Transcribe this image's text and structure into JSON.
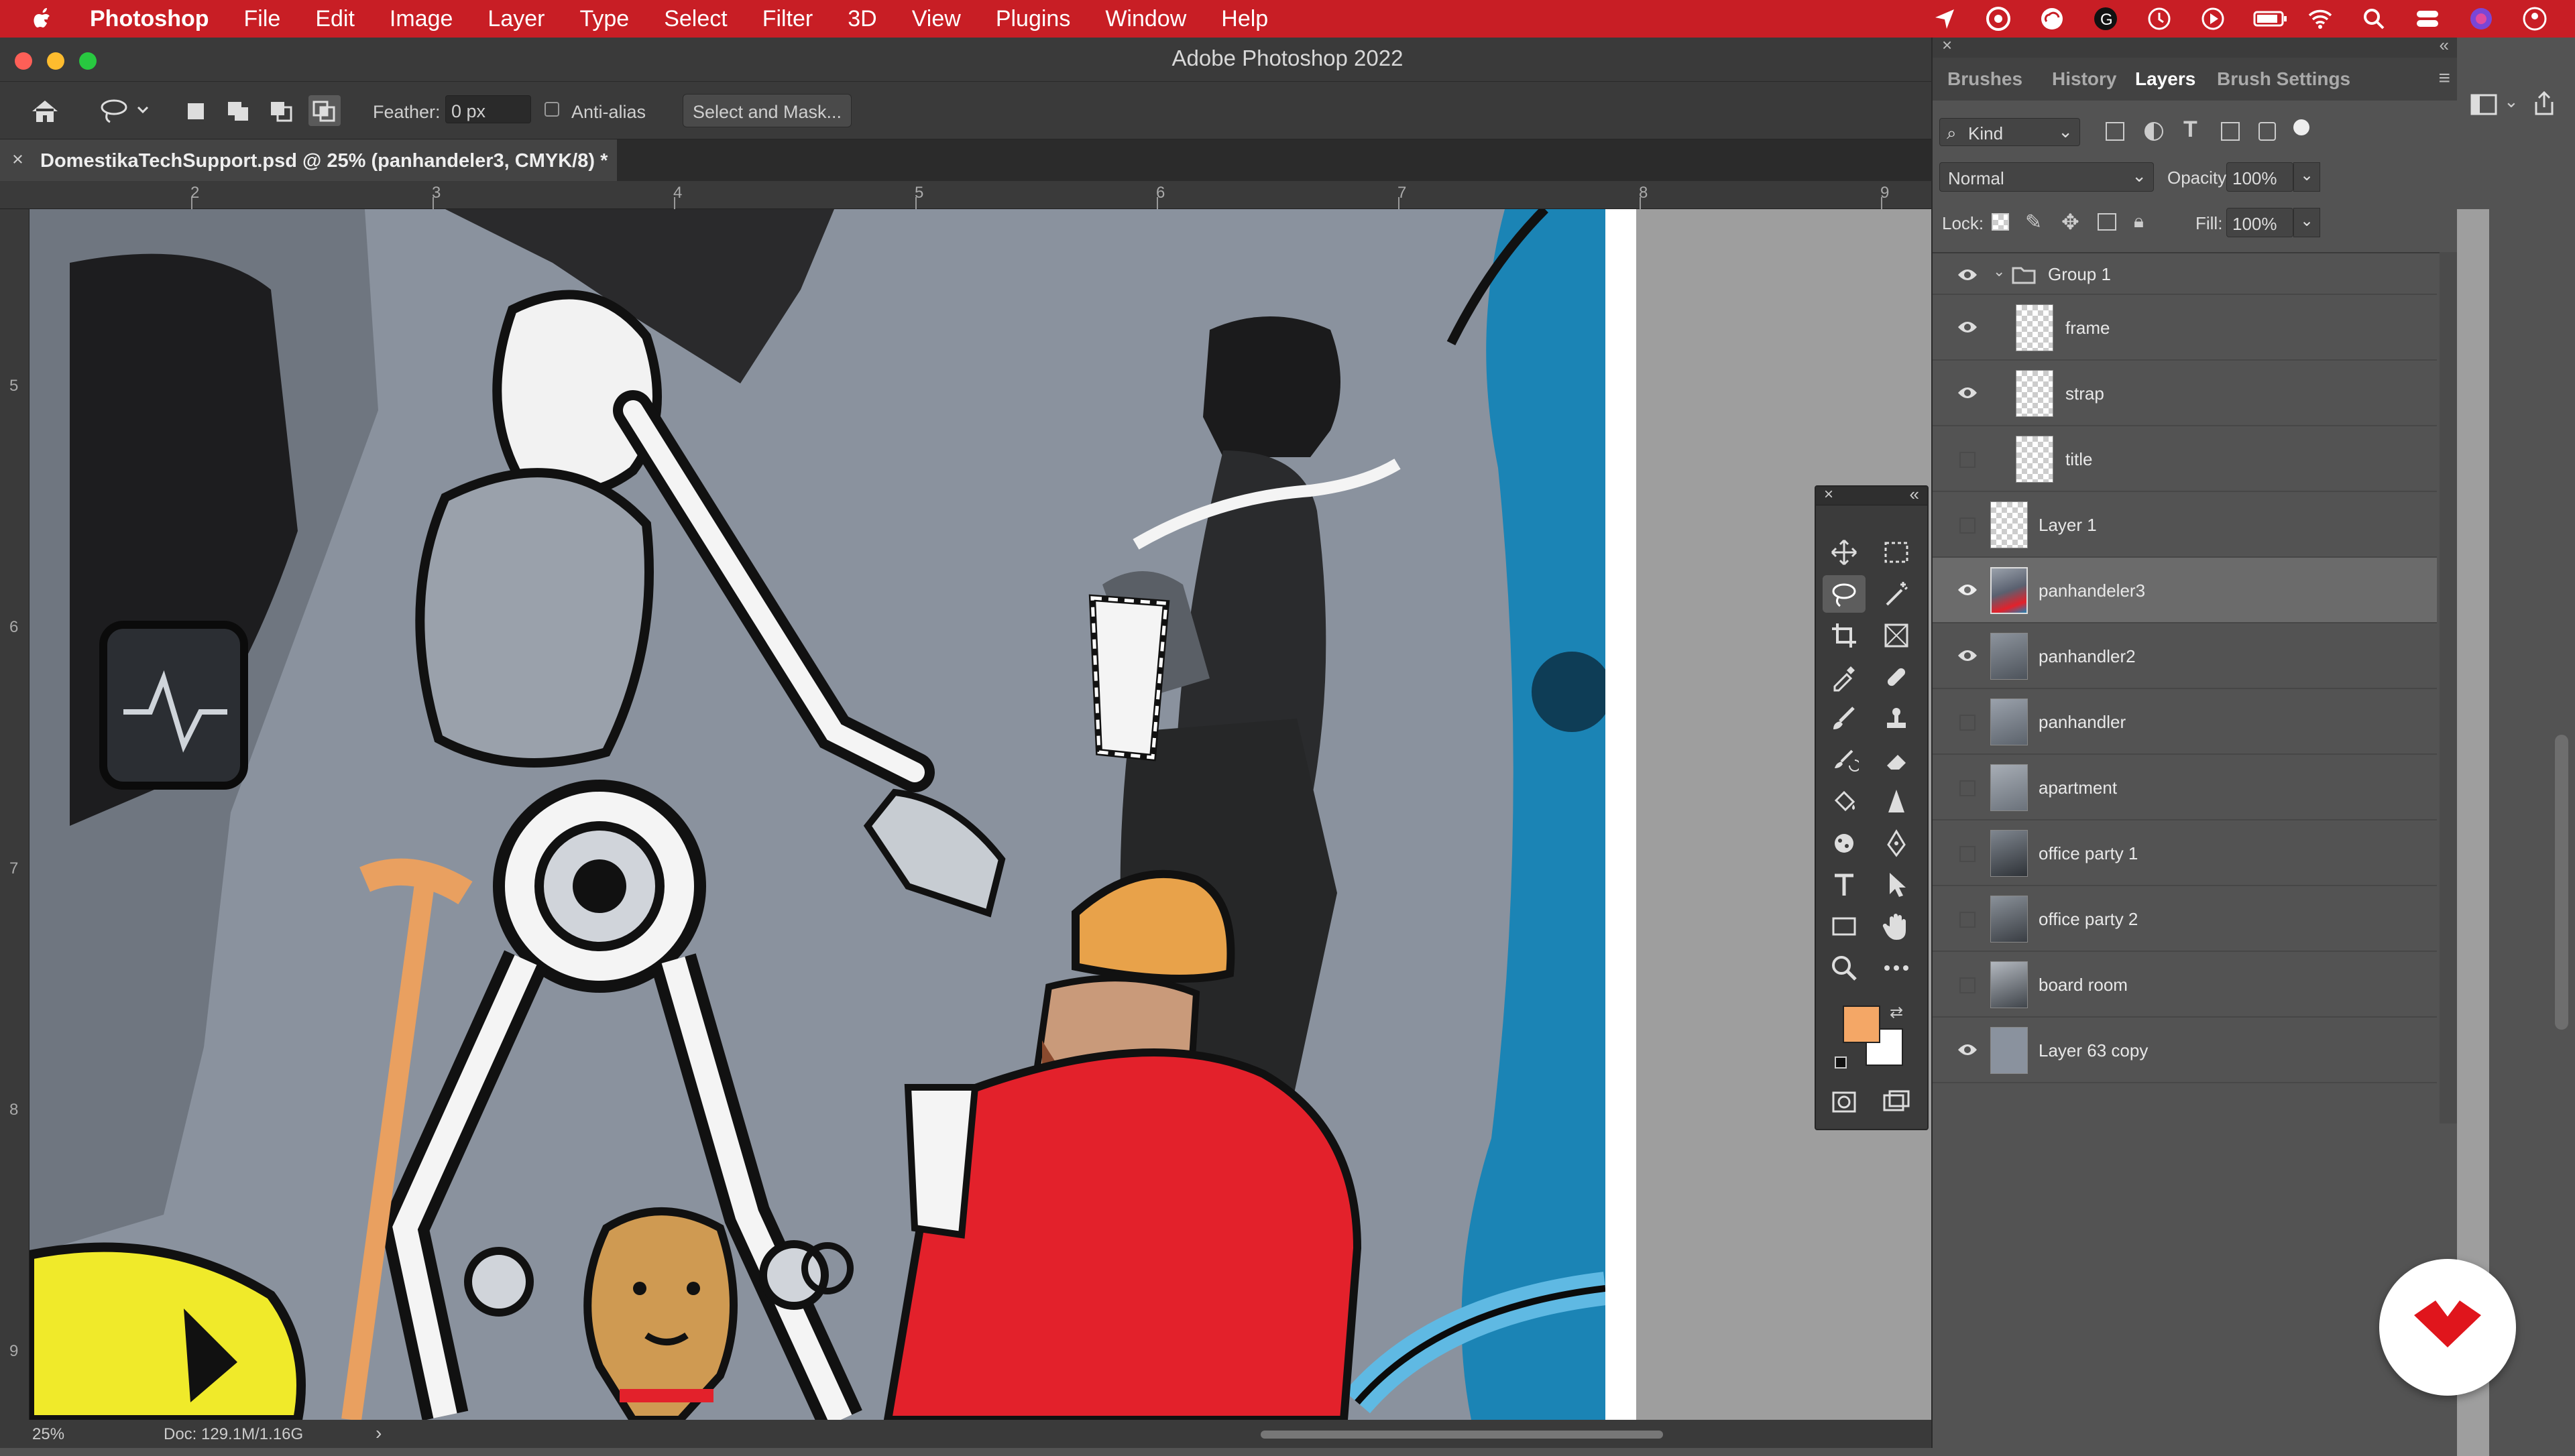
{
  "menubar": {
    "app_name": "Photoshop",
    "items": [
      "File",
      "Edit",
      "Image",
      "Layer",
      "Type",
      "Select",
      "Filter",
      "3D",
      "View",
      "Plugins",
      "Window",
      "Help"
    ]
  },
  "window": {
    "title": "Adobe Photoshop 2022"
  },
  "options": {
    "feather_label": "Feather:",
    "feather_value": "0 px",
    "antialias_label": "Anti-alias",
    "select_mask_label": "Select and Mask..."
  },
  "document": {
    "tab_title": "DomestikaTechSupport.psd @ 25% (panhandeler3, CMYK/8) *"
  },
  "rulers": {
    "h": [
      "2",
      "3",
      "4",
      "5",
      "6",
      "7",
      "8",
      "9"
    ],
    "v": [
      "5",
      "6",
      "7",
      "8",
      "9"
    ]
  },
  "status": {
    "zoom": "25%",
    "doc": "Doc: 129.1M/1.16G"
  },
  "panel": {
    "tabs": [
      "Brushes",
      "History",
      "Layers",
      "Brush Settings"
    ],
    "active_tab": "Layers",
    "filter_kind": "Kind",
    "blend_mode": "Normal",
    "opacity_label": "Opacity:",
    "opacity_value": "100%",
    "lock_label": "Lock:",
    "fill_label": "Fill:",
    "fill_value": "100%",
    "layers": [
      {
        "name": "Group 1",
        "visible": true,
        "type": "group"
      },
      {
        "name": "frame",
        "visible": true,
        "type": "child"
      },
      {
        "name": "strap",
        "visible": true,
        "type": "child"
      },
      {
        "name": "title",
        "visible": false,
        "type": "child"
      },
      {
        "name": "Layer 1",
        "visible": false,
        "type": "layer"
      },
      {
        "name": "panhandeler3",
        "visible": true,
        "type": "layer",
        "selected": true
      },
      {
        "name": "panhandler2",
        "visible": true,
        "type": "layer"
      },
      {
        "name": "panhandler",
        "visible": false,
        "type": "layer"
      },
      {
        "name": "apartment",
        "visible": false,
        "type": "layer"
      },
      {
        "name": "office party  1",
        "visible": false,
        "type": "layer"
      },
      {
        "name": "office party 2",
        "visible": false,
        "type": "layer"
      },
      {
        "name": "board room",
        "visible": false,
        "type": "layer"
      },
      {
        "name": "Layer 63 copy",
        "visible": true,
        "type": "layer"
      }
    ]
  },
  "colors": {
    "foreground": "#f4a766",
    "background": "#ffffff",
    "menubar": "#c81e25"
  }
}
